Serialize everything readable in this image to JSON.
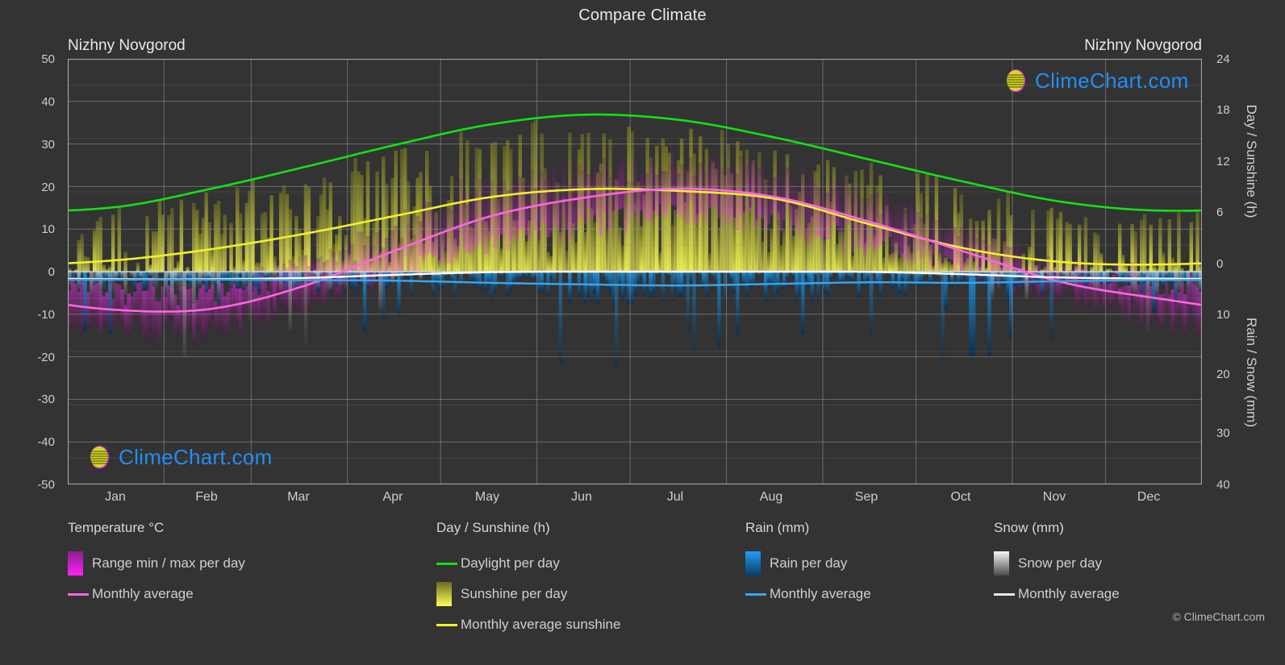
{
  "header": {
    "title": "Compare Climate",
    "city_left": "Nizhny Novgorod",
    "city_right": "Nizhny Novgorod"
  },
  "watermark": {
    "text": "ClimeChart.com",
    "copyright": "© ClimeChart.com"
  },
  "axes": {
    "left_title": "Temperature °C",
    "right_title_top": "Day / Sunshine (h)",
    "right_title_bottom": "Rain / Snow (mm)",
    "temp_ticks": [
      "50",
      "40",
      "30",
      "20",
      "10",
      "0",
      "-10",
      "-20",
      "-30",
      "-40",
      "-50"
    ],
    "sun_ticks": [
      "24",
      "18",
      "12",
      "6",
      "0"
    ],
    "precip_ticks": [
      "0",
      "10",
      "20",
      "30",
      "40"
    ],
    "months": [
      "Jan",
      "Feb",
      "Mar",
      "Apr",
      "May",
      "Jun",
      "Jul",
      "Aug",
      "Sep",
      "Oct",
      "Nov",
      "Dec"
    ]
  },
  "legend": {
    "temperature": {
      "heading": "Temperature °C",
      "items": [
        {
          "label": "Range min / max per day",
          "type": "gradient",
          "color": "#ff00ff"
        },
        {
          "label": "Monthly average",
          "type": "line",
          "color": "#ff66e0"
        }
      ]
    },
    "daysun": {
      "heading": "Day / Sunshine (h)",
      "items": [
        {
          "label": "Daylight per day",
          "type": "line",
          "color": "#14e014"
        },
        {
          "label": "Sunshine per day",
          "type": "gradient",
          "color": "#f2f24a"
        },
        {
          "label": "Monthly average sunshine",
          "type": "line",
          "color": "#f0f030"
        }
      ]
    },
    "rain": {
      "heading": "Rain (mm)",
      "items": [
        {
          "label": "Rain per day",
          "type": "gradient",
          "color": "#1288e8"
        },
        {
          "label": "Monthly average",
          "type": "line",
          "color": "#3aa6f0"
        }
      ]
    },
    "snow": {
      "heading": "Snow (mm)",
      "items": [
        {
          "label": "Snow per day",
          "type": "gradient",
          "color": "#ffffff"
        },
        {
          "label": "Monthly average",
          "type": "line",
          "color": "#ffffff"
        }
      ]
    }
  },
  "chart_data": {
    "type": "area",
    "title": "Compare Climate",
    "subtitle": "Nizhny Novgorod",
    "xlabel": "",
    "ylabel": "Temperature °C",
    "categories": [
      "Jan",
      "Feb",
      "Mar",
      "Apr",
      "May",
      "Jun",
      "Jul",
      "Aug",
      "Sep",
      "Oct",
      "Nov",
      "Dec"
    ],
    "axis_left": {
      "label": "Temperature °C",
      "min": -50,
      "max": 50,
      "step": 10
    },
    "axis_right_top": {
      "label": "Day / Sunshine (h)",
      "min": 0,
      "max": 24,
      "step": 6,
      "maps_to_temp": [
        0,
        50
      ]
    },
    "axis_right_bottom": {
      "label": "Rain / Snow (mm)",
      "min": 0,
      "max": 40,
      "step": 10,
      "maps_to_temp": [
        0,
        -50
      ]
    },
    "grid": true,
    "legend_position": "bottom",
    "series": [
      {
        "name": "Monthly average temperature",
        "unit": "°C",
        "color": "#ff66e0",
        "axis": "left",
        "values": [
          -9.0,
          -8.8,
          -3.6,
          5.0,
          13.0,
          17.4,
          19.5,
          17.5,
          11.6,
          4.6,
          -2.4,
          -6.2
        ]
      },
      {
        "name": "Daylight per day",
        "unit": "h",
        "color": "#14e014",
        "axis": "right_top",
        "values": [
          7.3,
          9.3,
          11.7,
          14.3,
          16.6,
          17.7,
          17.1,
          15.1,
          12.6,
          10.1,
          7.9,
          6.9
        ]
      },
      {
        "name": "Monthly average sunshine",
        "unit": "h",
        "color": "#f0f030",
        "axis": "right_top",
        "values": [
          1.3,
          2.5,
          4.2,
          6.3,
          8.4,
          9.3,
          9.1,
          8.2,
          5.3,
          2.6,
          1.1,
          0.8
        ]
      },
      {
        "name": "Monthly average rain",
        "unit": "mm",
        "color": "#3aa6f0",
        "axis": "right_bottom",
        "values": [
          1.5,
          1.5,
          1.6,
          1.7,
          2.1,
          2.4,
          2.6,
          2.3,
          2.0,
          2.1,
          1.8,
          1.6
        ]
      },
      {
        "name": "Monthly average snow",
        "unit": "mm",
        "color": "#ffffff",
        "axis": "right_bottom",
        "values": [
          1.4,
          1.4,
          1.2,
          0.6,
          0.1,
          0.0,
          0.0,
          0.0,
          0.05,
          0.5,
          1.1,
          1.3
        ]
      },
      {
        "name": "Temperature range min per day",
        "unit": "°C",
        "color": "#cc22cc",
        "axis": "left",
        "values": [
          -13.5,
          -13.0,
          -8.0,
          0.5,
          7.5,
          12.0,
          14.5,
          12.5,
          7.0,
          1.0,
          -5.5,
          -10.5
        ]
      },
      {
        "name": "Temperature range max per day",
        "unit": "°C",
        "color": "#ff33ff",
        "axis": "left",
        "values": [
          -5.0,
          -4.5,
          1.0,
          10.0,
          19.0,
          23.0,
          24.5,
          22.5,
          16.5,
          8.5,
          0.5,
          -2.5
        ]
      }
    ]
  }
}
